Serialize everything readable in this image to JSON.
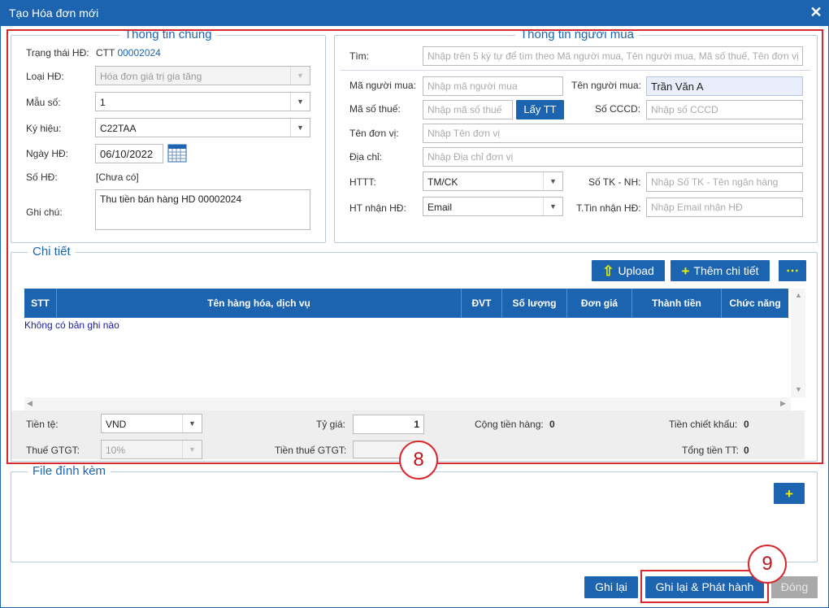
{
  "window": {
    "title": "Tạo Hóa đơn mới",
    "close_icon": "close-icon"
  },
  "general": {
    "legend": "Thông tin chung",
    "status_label": "Trạng thái HĐ:",
    "status_code": "CTT",
    "status_number": "00002024",
    "invoice_type_label": "Loại HĐ:",
    "invoice_type_value": "Hóa đơn giá trị gia tăng",
    "template_label": "Mẫu số:",
    "template_value": "1",
    "symbol_label": "Ký hiệu:",
    "symbol_value": "C22TAA",
    "date_label": "Ngày HĐ:",
    "date_value": "06/10/2022",
    "calendar_icon": "calendar-icon",
    "number_label": "Số HĐ:",
    "number_value": "[Chưa có]",
    "note_label": "Ghi chú:",
    "note_value": "Thu tiền bán hàng HD 00002024"
  },
  "buyer": {
    "legend": "Thông tin người mua",
    "search_label": "Tìm:",
    "search_placeholder": "Nhập trên 5 ký tự để tìm theo Mã người mua, Tên người mua, Mã số thuế, Tên đơn vị",
    "buyer_code_label": "Mã người mua:",
    "buyer_code_placeholder": "Nhập mã người mua",
    "buyer_name_label": "Tên người mua:",
    "buyer_name_value": "Trần Văn A",
    "tax_code_label": "Mã số thuế:",
    "tax_code_placeholder": "Nhập mã số thuế",
    "fetch_button": "Lấy TT",
    "id_label": "Số CCCD:",
    "id_placeholder": "Nhập số CCCD",
    "unit_label": "Tên đơn vị:",
    "unit_placeholder": "Nhập Tên đơn vị",
    "address_label": "Địa chỉ:",
    "address_placeholder": "Nhập Địa chỉ đơn vị",
    "payment_label": "HTTT:",
    "payment_value": "TM/CK",
    "bank_label": "Số TK - NH:",
    "bank_placeholder": "Nhập Số TK - Tên ngân hàng",
    "receive_label": "HT nhận HĐ:",
    "receive_value": "Email",
    "receive_info_label": "T.Tin nhận HĐ:",
    "receive_info_placeholder": "Nhập Email nhận HĐ"
  },
  "detail": {
    "legend": "Chi tiết",
    "upload_button": "Upload",
    "upload_icon": "upload-icon",
    "add_button": "Thêm chi tiết",
    "add_icon": "plus-icon",
    "more_button": "⋯",
    "columns": [
      "STT",
      "Tên hàng hóa, dịch vụ",
      "ĐVT",
      "Số lượng",
      "Đơn giá",
      "Thành tiền",
      "Chức năng"
    ],
    "empty_text": "Không có bản ghi nào"
  },
  "summary": {
    "currency_label": "Tiền tệ:",
    "currency_value": "VND",
    "rate_label": "Tỷ giá:",
    "rate_value": "1",
    "subtotal_label": "Cộng tiền hàng:",
    "subtotal_value": "0",
    "discount_label": "Tiền chiết khấu:",
    "discount_value": "0",
    "vat_label": "Thuế GTGT:",
    "vat_value": "10%",
    "vat_amount_label": "Tiền thuế GTGT:",
    "total_label": "Tổng tiền TT:",
    "total_value": "0"
  },
  "attachments": {
    "legend": "File đính kèm",
    "add_icon": "plus-icon"
  },
  "actions": {
    "save": "Ghi lại",
    "save_publish": "Ghi lại & Phát hành",
    "close": "Đóng"
  },
  "callouts": {
    "step8": "8",
    "step9": "9"
  },
  "colors": {
    "primary": "#1d64b0",
    "highlight": "#d9272e",
    "accent_icon": "#e7f000"
  }
}
